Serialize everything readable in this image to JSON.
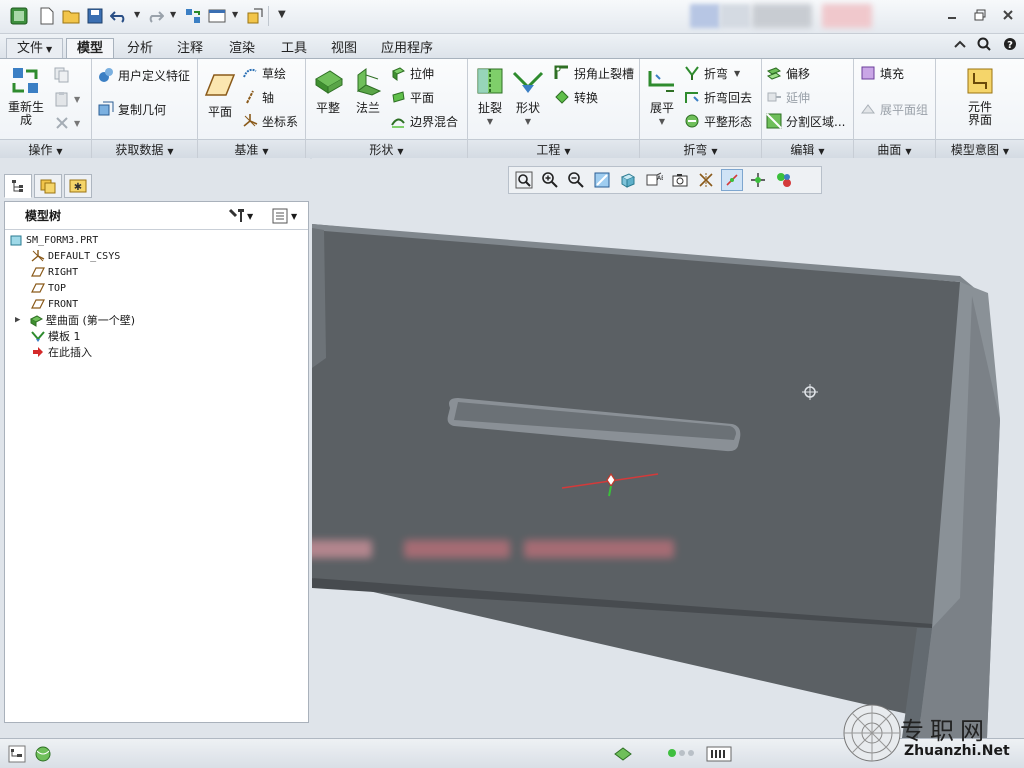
{
  "tabs": {
    "file": "文件",
    "items": [
      "模型",
      "分析",
      "注释",
      "渲染",
      "工具",
      "视图",
      "应用程序"
    ]
  },
  "ribbon": {
    "operations": {
      "label": "操作",
      "regenerate": "重新生\n成"
    },
    "get_data": {
      "label": "获取数据",
      "user_feature": "用户定义特征",
      "copy_geometry": "复制几何"
    },
    "datum": {
      "label": "基准",
      "plane": "平面",
      "sketch": "草绘",
      "axis": "轴",
      "csys": "坐标系"
    },
    "shapes": {
      "label": "形状",
      "planar": "平整",
      "flange": "法兰",
      "extrude": "拉伸",
      "flat": "平面",
      "blend": "边界混合"
    },
    "engineering": {
      "label": "工程",
      "rip": "扯裂",
      "form": "形状",
      "corner_relief": "拐角止裂槽",
      "convert": "转换"
    },
    "bends": {
      "label": "折弯",
      "unbend": "展平",
      "bend": "折弯",
      "bend_back": "折弯回去",
      "flatten_form": "平整形态"
    },
    "editing": {
      "label": "编辑",
      "offset": "偏移",
      "extend": "延伸",
      "split_area": "分割区域..."
    },
    "surfaces": {
      "label": "曲面",
      "fill": "填充",
      "flat_quilt": "展平面组"
    },
    "model_intent": {
      "label": "模型意图",
      "component_interface": "元件\n界面"
    }
  },
  "model_tree": {
    "title": "模型树",
    "items": [
      {
        "label": "SM_FORM3.PRT",
        "icon": "part-icon"
      },
      {
        "label": "DEFAULT_CSYS",
        "icon": "csys-icon"
      },
      {
        "label": "RIGHT",
        "icon": "datum-plane-icon"
      },
      {
        "label": "TOP",
        "icon": "datum-plane-icon"
      },
      {
        "label": "FRONT",
        "icon": "datum-plane-icon"
      },
      {
        "label": "壁曲面 (第一个壁)",
        "icon": "wall-icon"
      },
      {
        "label": "模板 1",
        "icon": "form-icon"
      },
      {
        "label": "在此插入",
        "icon": "insert-here-icon"
      }
    ]
  },
  "watermark": {
    "text": "Zhuanzhi.Net"
  },
  "colors": {
    "accent": "#2f6fb4",
    "model_face": "#5b6064",
    "model_edge": "#7b8187"
  }
}
